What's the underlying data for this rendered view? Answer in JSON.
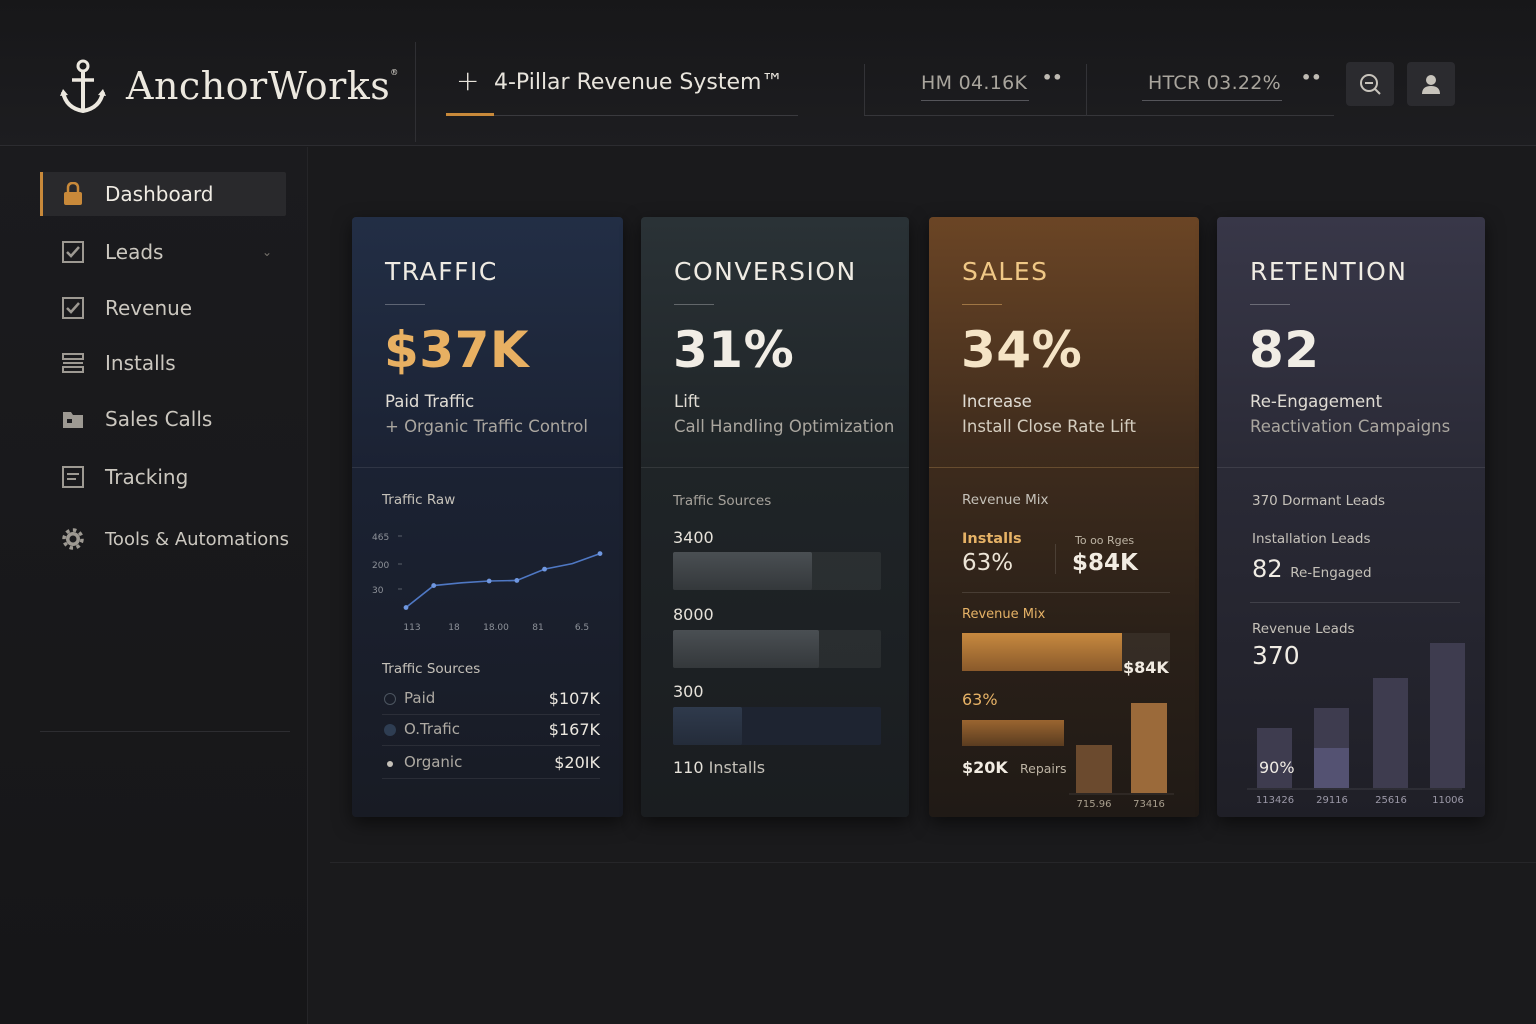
{
  "app": {
    "name": "AnchorWorks",
    "mark": "®"
  },
  "header": {
    "system_title": "4-Pillar Revenue System™",
    "metric1": "HM 04.16K",
    "metric2": "HTCR 03.22%",
    "dots": "••"
  },
  "sidebar": {
    "items": [
      {
        "label": "Dashboard",
        "icon": "lock-icon",
        "active": true
      },
      {
        "label": "Leads",
        "icon": "checkbox-icon",
        "chevron": "⌄"
      },
      {
        "label": "Revenue",
        "icon": "checkbox-icon"
      },
      {
        "label": "Installs",
        "icon": "list-icon"
      },
      {
        "label": "Sales Calls",
        "icon": "folder-icon"
      },
      {
        "label": "Tracking",
        "icon": "document-icon"
      },
      {
        "label": "Tools & Automations",
        "icon": "gear-icon"
      }
    ]
  },
  "cards": {
    "traffic": {
      "title": "TRAFFIC",
      "value": "$37K",
      "sub1": "Paid Traffic",
      "sub2": "+ Organic Traffic Control",
      "chart_label": "Traffic Raw",
      "sources_label": "Traffic Sources",
      "sources": [
        {
          "name": "Paid",
          "value": "$107K"
        },
        {
          "name": "O.Trafic",
          "value": "$167K"
        },
        {
          "name": "Organic",
          "value": "$20IK"
        }
      ]
    },
    "conversion": {
      "title": "CONVERSION",
      "value": "31%",
      "sub1": "Lift",
      "sub2": "Call Handling Optimization",
      "sources_label": "Traffic Sources",
      "bars": [
        {
          "label": "3400",
          "fill": 0.67
        },
        {
          "label": "8000",
          "fill": 0.7
        },
        {
          "label": "300",
          "fill": 0.33
        }
      ],
      "installs_num": "110",
      "installs_label": "Installs"
    },
    "sales": {
      "title": "SALES",
      "value": "34%",
      "sub1": "Increase",
      "sub2": "Install Close Rate Lift",
      "mix_label": "Revenue Mix",
      "installs_label": "Installs",
      "installs_pct": "63%",
      "total_label": "To oo Rges",
      "total_value": "$84K",
      "mix_label2": "Revenue Mix",
      "bar_value": "$84K",
      "bar_pct": "63%",
      "repairs_value": "$20K",
      "repairs_label": "Repairs",
      "x_labels": [
        "715.96",
        "73416"
      ]
    },
    "retention": {
      "title": "RETENTION",
      "value": "82",
      "sub1": "Re-Engagement",
      "sub2": "Reactivation Campaigns",
      "dormant": "370 Dormant Leads",
      "install_label": "Installation Leads",
      "reengaged_num": "82",
      "reengaged_label": "Re-Engaged",
      "rev_label": "Revenue Leads",
      "rev_value": "370",
      "pct": "90%"
    }
  },
  "chart_data": [
    {
      "type": "line",
      "title": "Traffic Raw",
      "x": [
        "113",
        "18",
        "18.00",
        "81",
        "6.5"
      ],
      "y_ticks": [
        "465",
        "200",
        "30"
      ],
      "values": [
        30,
        150,
        165,
        175,
        178,
        240,
        270,
        325
      ],
      "ylim": [
        0,
        465
      ]
    },
    {
      "type": "bar",
      "title": "Revenue Mix",
      "categories": [
        "715.96",
        "73416"
      ],
      "values": [
        48,
        90
      ]
    },
    {
      "type": "bar",
      "title": "Revenue Leads",
      "categories": [
        "113426",
        "29116",
        "25616",
        "11006"
      ],
      "series": [
        {
          "values": [
            60,
            80,
            110,
            145
          ]
        },
        {
          "values": [
            0,
            40,
            0,
            0
          ]
        }
      ]
    }
  ],
  "colors": {
    "accent": "#c8893a",
    "gold_text": "#e6b266"
  }
}
